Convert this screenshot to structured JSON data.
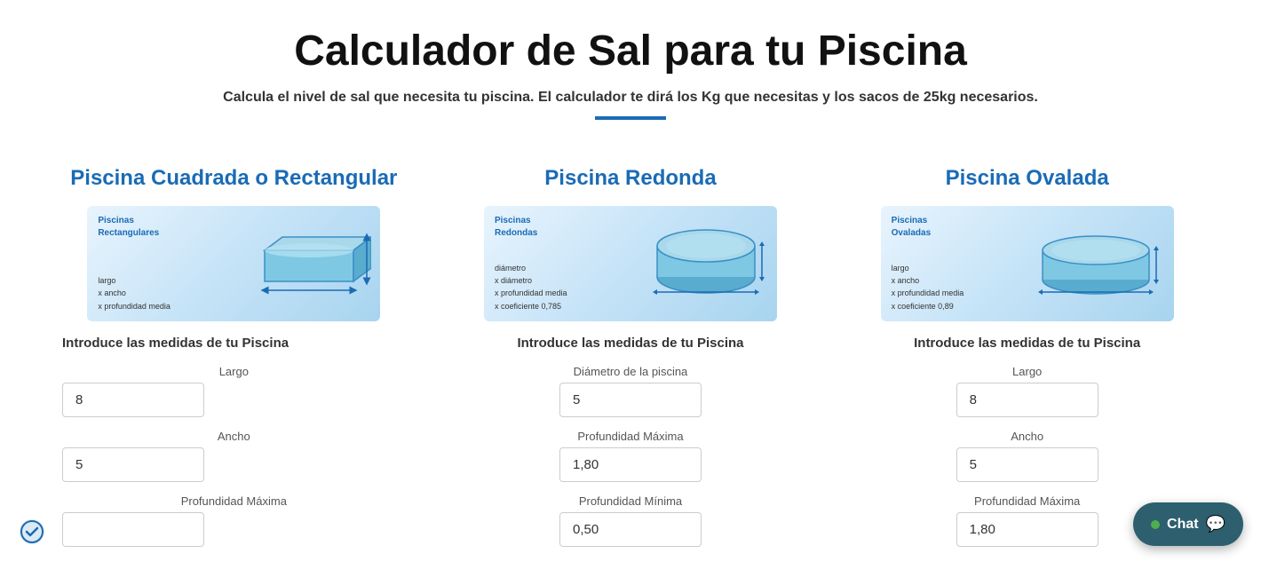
{
  "header": {
    "title": "Calculador de Sal para tu Piscina",
    "subtitle": "Calcula el nivel de sal que necesita tu piscina. El calculador te dirá los Kg que necesitas y los sacos de 25kg necesarios.",
    "divider_color": "#1a6bb5"
  },
  "sections": {
    "rectangular": {
      "title": "Piscina Cuadrada o Rectangular",
      "image_label": "Piscinas\nRectangulares",
      "image_formula": "largo\nx ancho\nx profundidad media",
      "intro": "Introduce las medidas de tu Piscina",
      "fields": [
        {
          "label": "Largo",
          "value": "8",
          "placeholder": ""
        },
        {
          "label": "Ancho",
          "value": "5",
          "placeholder": ""
        },
        {
          "label": "Profundidad Máxima",
          "value": "",
          "placeholder": ""
        }
      ]
    },
    "round": {
      "title": "Piscina Redonda",
      "image_label": "Piscinas\nRedondas",
      "image_formula": "diámetro\nx diámetro\nx profundidad media\nx coeficiente 0,785",
      "intro": "Introduce las medidas de tu Piscina",
      "fields": [
        {
          "label": "Diámetro de la piscina",
          "value": "5",
          "placeholder": ""
        },
        {
          "label": "Profundidad Máxima",
          "value": "1,80",
          "placeholder": ""
        },
        {
          "label": "Profundidad Mínima",
          "value": "0,50",
          "placeholder": ""
        }
      ]
    },
    "oval": {
      "title": "Piscina Ovalada",
      "image_label": "Piscinas\nOvaladas",
      "image_formula": "largo\nx ancho\nx profundidad media\nx coeficiente 0,89",
      "intro": "Introduce las medidas de tu Piscina",
      "fields": [
        {
          "label": "Largo",
          "value": "8",
          "placeholder": ""
        },
        {
          "label": "Ancho",
          "value": "5",
          "placeholder": ""
        },
        {
          "label": "Profundidad Máxima",
          "value": "1,80",
          "placeholder": ""
        }
      ]
    }
  },
  "chat": {
    "label": "Chat",
    "bg_color": "#2d5f6e",
    "dot_color": "#4caf50"
  }
}
